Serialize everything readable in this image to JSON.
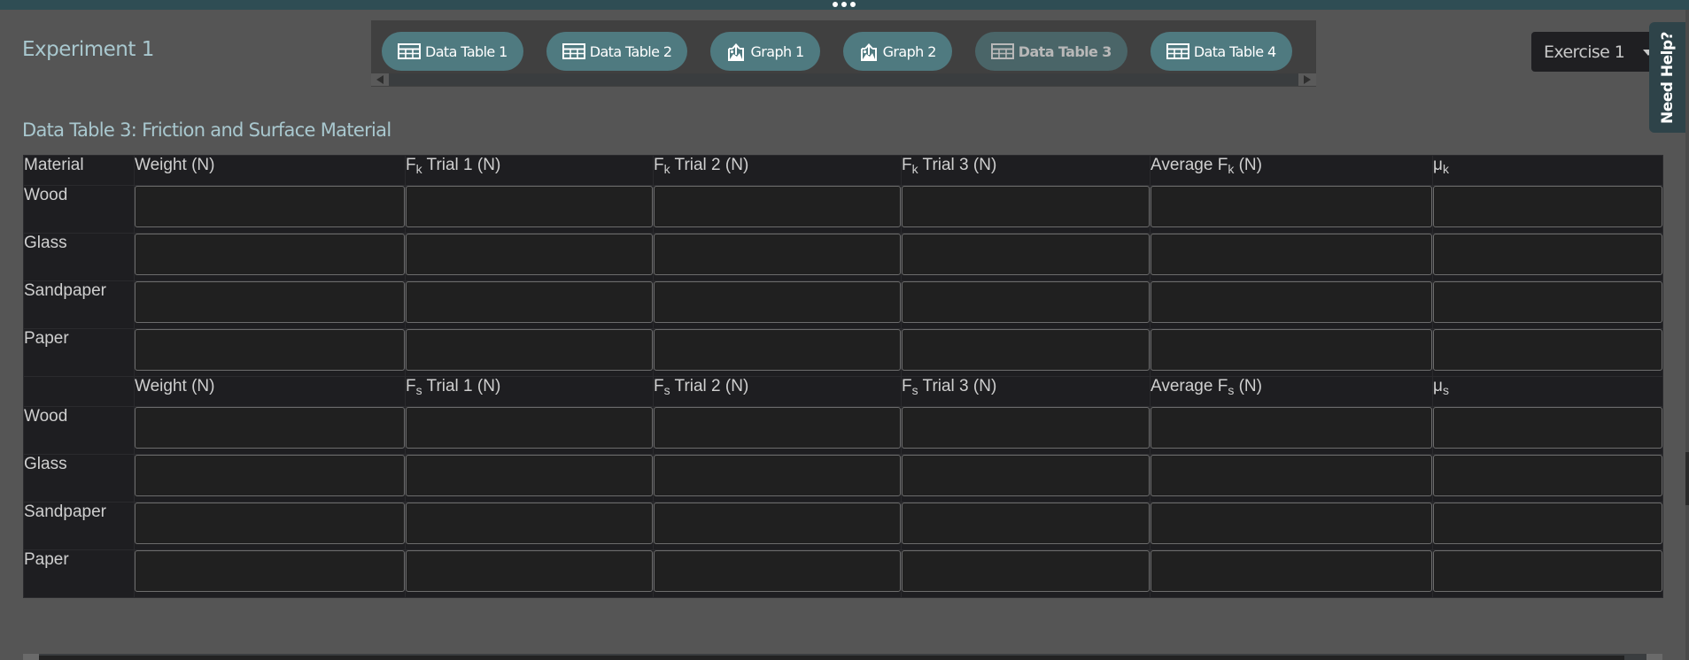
{
  "header": {
    "experiment_title": "Experiment 1",
    "exercise_select": {
      "selected": "Exercise 1"
    },
    "need_help_label": "Need Help?"
  },
  "tabs": [
    {
      "label": "Data Table 1",
      "icon": "table-icon",
      "active": false
    },
    {
      "label": "Data Table 2",
      "icon": "table-icon",
      "active": false
    },
    {
      "label": "Graph 1",
      "icon": "graph-upload-icon",
      "active": false
    },
    {
      "label": "Graph 2",
      "icon": "graph-upload-icon",
      "active": false
    },
    {
      "label": "Data Table 3",
      "icon": "table-icon",
      "active": true
    },
    {
      "label": "Data Table 4",
      "icon": "table-icon",
      "active": false
    }
  ],
  "table": {
    "title": "Data Table 3: Friction and Surface Material",
    "kinetic_header": {
      "material": "Material",
      "weight": "Weight (N)",
      "trial1": {
        "base": "F",
        "sub": "k",
        "rest": " Trial 1 (N)"
      },
      "trial2": {
        "base": "F",
        "sub": "k",
        "rest": " Trial 2 (N)"
      },
      "trial3": {
        "base": "F",
        "sub": "k",
        "rest": " Trial 3 (N)"
      },
      "average": {
        "base": "Average F",
        "sub": "k",
        "rest": " (N)"
      },
      "mu": {
        "base": "μ",
        "sub": "k",
        "rest": ""
      }
    },
    "static_header": {
      "material": "",
      "weight": "Weight (N)",
      "trial1": {
        "base": "F",
        "sub": "s",
        "rest": " Trial 1 (N)"
      },
      "trial2": {
        "base": "F",
        "sub": "s",
        "rest": " Trial 2 (N)"
      },
      "trial3": {
        "base": "F",
        "sub": "s",
        "rest": " Trial 3 (N)"
      },
      "average": {
        "base": "Average F",
        "sub": "s",
        "rest": " (N)"
      },
      "mu": {
        "base": "μ",
        "sub": "s",
        "rest": ""
      }
    },
    "materials": [
      "Wood",
      "Glass",
      "Sandpaper",
      "Paper"
    ],
    "kinetic_values": [
      [
        "",
        "",
        "",
        "",
        "",
        ""
      ],
      [
        "",
        "",
        "",
        "",
        "",
        ""
      ],
      [
        "",
        "",
        "",
        "",
        "",
        ""
      ],
      [
        "",
        "",
        "",
        "",
        "",
        ""
      ]
    ],
    "static_values": [
      [
        "",
        "",
        "",
        "",
        "",
        ""
      ],
      [
        "",
        "",
        "",
        "",
        "",
        ""
      ],
      [
        "",
        "",
        "",
        "",
        "",
        ""
      ],
      [
        "",
        "",
        "",
        "",
        "",
        ""
      ]
    ]
  },
  "colors": {
    "topbar": "#2f4d54",
    "background": "#555555",
    "accent_text": "#a9c8cf",
    "tab_pill": "#4f7a80",
    "tab_active": "#4a6568",
    "table_bg": "#1e1e21",
    "need_help_bg": "#2e4349"
  }
}
